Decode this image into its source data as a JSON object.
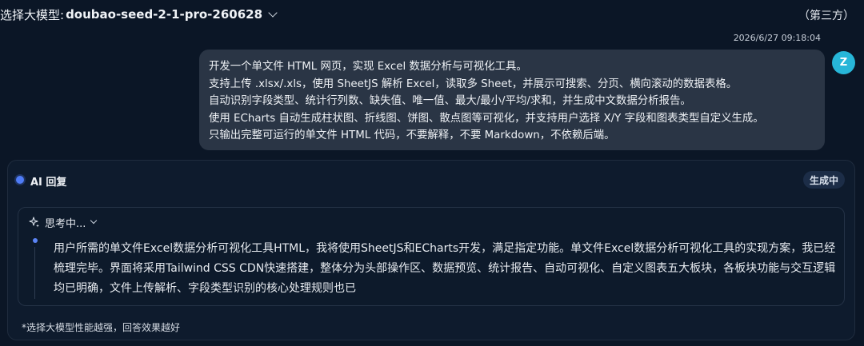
{
  "header": {
    "model_label": "选择大模型:",
    "model_name": "doubao-seed-2-1-pro-260628",
    "third_party": "（第三方）"
  },
  "message": {
    "timestamp": "2026/6/27 09:18:04",
    "avatar_letter": "Z",
    "lines": [
      "开发一个单文件 HTML 网页，实现 Excel 数据分析与可视化工具。",
      "支持上传 .xlsx/.xls，使用 SheetJS 解析 Excel，读取多 Sheet，并展示可搜索、分页、横向滚动的数据表格。",
      "自动识别字段类型、统计行列数、缺失值、唯一值、最大/最小/平均/求和，并生成中文数据分析报告。",
      "使用 ECharts 自动生成柱状图、折线图、饼图、散点图等可视化，并支持用户选择 X/Y 字段和图表类型自定义生成。",
      "只输出完整可运行的单文件 HTML 代码，不要解释，不要 Markdown，不依赖后端。"
    ]
  },
  "ai": {
    "title": "AI 回复",
    "status": "生成中",
    "thinking_label": "思考中...",
    "thinking_text": "用户所需的单文件Excel数据分析可视化工具HTML，我将使用SheetJS和ECharts开发，满足指定功能。单文件Excel数据分析可视化工具的实现方案，我已经梳理完毕。界面将采用Tailwind CSS CDN快速搭建，整体分为头部操作区、数据预览、统计报告、自动可视化、自定义图表五大板块，各板块功能与交互逻辑均已明确，文件上传解析、字段类型识别的核心处理规则也已",
    "footer_note": "*选择大模型性能越强，回答效果越好"
  },
  "icons": {
    "model_dropdown": "chevron-down-icon",
    "thinking_toggle": "chevron-down-icon",
    "thinking": "sparkle-icon"
  },
  "colors": {
    "background": "#0b1626",
    "user_bubble": "#2a3545",
    "avatar": "#27b6d8",
    "accent": "#4f7cf6"
  }
}
